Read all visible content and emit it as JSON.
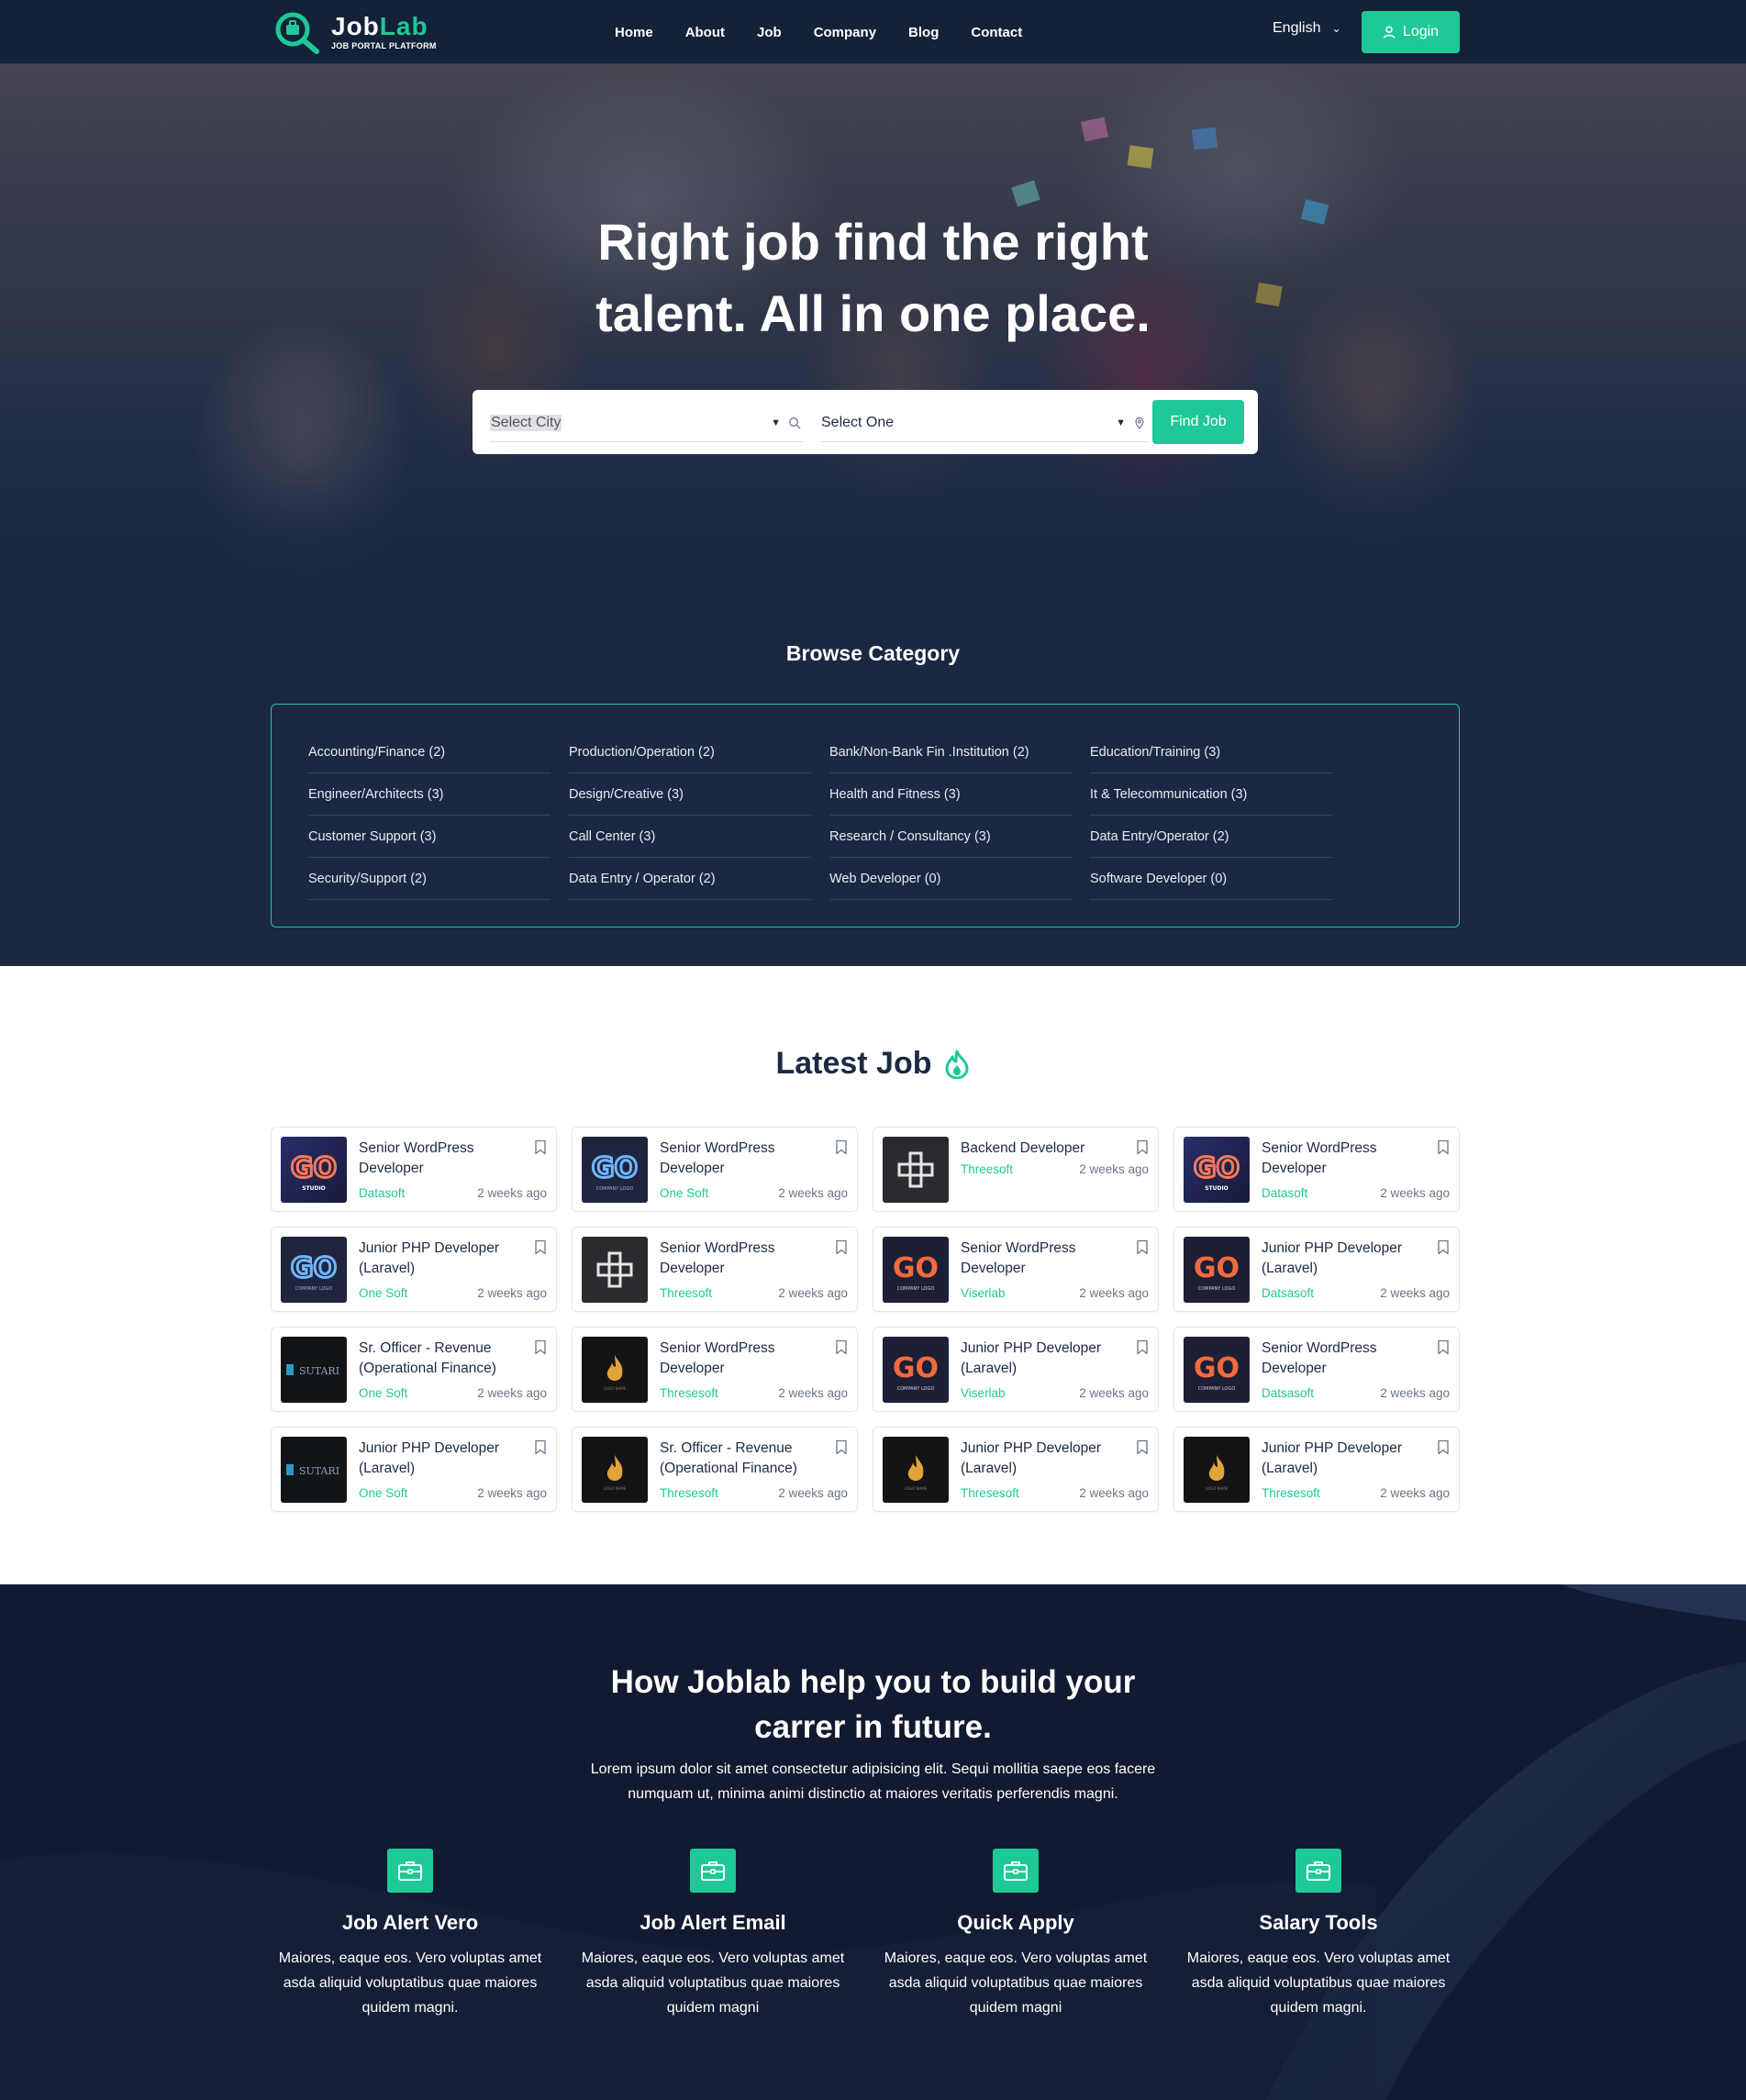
{
  "brand": {
    "name_main": "Job",
    "name_accent": "Lab",
    "tagline": "JOB PORTAL PLATFORM",
    "accent_color": "#1ec997",
    "dark_color": "#142238"
  },
  "nav": {
    "items": [
      "Home",
      "About",
      "Job",
      "Company",
      "Blog",
      "Contact"
    ]
  },
  "header": {
    "language": "English",
    "login_label": "Login"
  },
  "hero": {
    "title_line1": "Right job find the right",
    "title_line2": "talent. All in one place.",
    "city_select": "Select City",
    "category_select": "Select One",
    "find_button": "Find Job"
  },
  "browse": {
    "title": "Browse Category",
    "categories": [
      "Accounting/Finance (2)",
      "Production/Operation (2)",
      "Bank/Non-Bank Fin .Institution (2)",
      "Education/Training (3)",
      "Engineer/Architects (3)",
      "Design/Creative (3)",
      "Health and Fitness (3)",
      "It & Telecommunication (3)",
      "Customer Support (3)",
      "Call Center (3)",
      "Research / Consultancy (3)",
      "Data Entry/Operator (2)",
      "Security/Support (2)",
      "Data Entry / Operator (2)",
      "Web Developer (0)",
      "Software Developer (0)"
    ]
  },
  "latest": {
    "title": "Latest Job",
    "jobs": [
      {
        "title": "Senior WordPress Developer",
        "company": "Datasoft",
        "time": "2 weeks ago",
        "logo": "go-studio"
      },
      {
        "title": "Senior WordPress Developer",
        "company": "One Soft",
        "time": "2 weeks ago",
        "logo": "go-blue"
      },
      {
        "title": "Backend Developer",
        "company": "Threesoft",
        "time": "2 weeks ago",
        "logo": "cross"
      },
      {
        "title": "Senior WordPress Developer",
        "company": "Datasoft",
        "time": "2 weeks ago",
        "logo": "go-studio"
      },
      {
        "title": "Junior PHP Developer (Laravel)",
        "company": "One Soft",
        "time": "2 weeks ago",
        "logo": "go-blue"
      },
      {
        "title": "Senior WordPress Developer",
        "company": "Threesoft",
        "time": "2 weeks ago",
        "logo": "cross"
      },
      {
        "title": "Senior WordPress Developer",
        "company": "Viserlab",
        "time": "2 weeks ago",
        "logo": "go-orange"
      },
      {
        "title": "Junior PHP Developer (Laravel)",
        "company": "Datsasoft",
        "time": "2 weeks ago",
        "logo": "go-orange"
      },
      {
        "title": "Sr. Officer - Revenue (Operational Finance)",
        "company": "One Soft",
        "time": "2 weeks ago",
        "logo": "sutari"
      },
      {
        "title": "Senior WordPress Developer",
        "company": "Thresesoft",
        "time": "2 weeks ago",
        "logo": "flame"
      },
      {
        "title": "Junior PHP Developer (Laravel)",
        "company": "Viserlab",
        "time": "2 weeks ago",
        "logo": "go-orange"
      },
      {
        "title": "Senior WordPress Developer",
        "company": "Datsasoft",
        "time": "2 weeks ago",
        "logo": "go-orange"
      },
      {
        "title": "Junior PHP Developer (Laravel)",
        "company": "One Soft",
        "time": "2 weeks ago",
        "logo": "sutari"
      },
      {
        "title": "Sr. Officer - Revenue (Operational Finance)",
        "company": "Thresesoft",
        "time": "2 weeks ago",
        "logo": "flame"
      },
      {
        "title": "Junior PHP Developer (Laravel)",
        "company": "Thresesoft",
        "time": "2 weeks ago",
        "logo": "flame"
      },
      {
        "title": "Junior PHP Developer (Laravel)",
        "company": "Thresesoft",
        "time": "2 weeks ago",
        "logo": "flame"
      }
    ]
  },
  "how": {
    "title_line1": "How Joblab help you to build your",
    "title_line2": "carrer in future.",
    "text": "Lorem ipsum dolor sit amet consectetur adipisicing elit. Sequi mollitia saepe eos facere numquam ut, minima animi distinctio at maiores veritatis perferendis magni.",
    "features": [
      {
        "title": "Job Alert Vero",
        "text": "Maiores, eaque eos. Vero voluptas amet asda aliquid voluptatibus quae maiores quidem magni."
      },
      {
        "title": "Job Alert Email",
        "text": "Maiores, eaque eos. Vero voluptas amet asda aliquid voluptatibus quae maiores quidem magni"
      },
      {
        "title": "Quick Apply",
        "text": "Maiores, eaque eos. Vero voluptas amet asda aliquid voluptatibus quae maiores quidem magni"
      },
      {
        "title": "Salary Tools",
        "text": "Maiores, eaque eos. Vero voluptas amet asda aliquid voluptatibus quae maiores quidem magni."
      }
    ]
  }
}
